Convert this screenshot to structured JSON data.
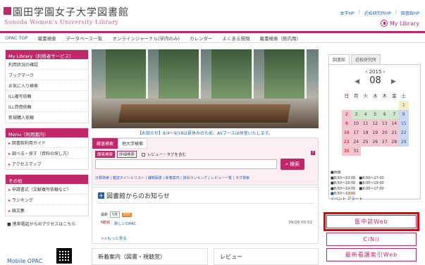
{
  "header": {
    "title": "園田学園女子大学図書館",
    "subtitle": "Sonoda Women's University Library",
    "top_links": [
      "本学HP",
      "近松研究所HP",
      "図書館HP"
    ],
    "mylibrary": "My Library"
  },
  "nav": [
    "OPAC TOP",
    "蔵書検索",
    "データベース一覧",
    "オンラインジャーナル(学内のみ)",
    "カレンダー",
    "よくある質問",
    "蔵書検索（館内用）"
  ],
  "sidebar": {
    "mylibrary": {
      "title": "My Library（利用者サービス）",
      "items": [
        "利用状況の確認",
        "ブックマーク",
        "お気に入り検索",
        "ILL複写依頼",
        "ILL貸借依頼",
        "新規購入依頼"
      ]
    },
    "menu": {
      "title": "Menu（利用案内）",
      "items": [
        "図書館利用ガイド",
        "調べる・探す（資料の探し方）",
        "アクセスマップ"
      ]
    },
    "other": {
      "title": "その他",
      "items": [
        "申請書式（文献複写依頼など）",
        "ランキング",
        "論文集"
      ]
    },
    "mobile_note": "■ 携帯電話からのアクセスはこちら",
    "mobile_label": "Mobile OPAC"
  },
  "notice": "【お知らせ】8/4～9/18は夏休みのため、AVブースは休室いたします。",
  "search": {
    "tabs": [
      "蔵書検索",
      "他大学検索"
    ],
    "modes": [
      "簡易検索",
      "詳細検索"
    ],
    "review_checkbox": "レビュー・タグを含む",
    "help": "?",
    "button": "検索",
    "links": "分類検索 | 雑誌タイトルリスト | 課題図書 | 新着案内 | 貸出ランキング | レビュー一覧 | タグ検索"
  },
  "news": {
    "title": "図書館からのお知らせ",
    "controls": [
      "最新",
      "5件",
      "RSS"
    ],
    "items": [
      {
        "badge": "NEW",
        "title": "新しいOPAC",
        "date": "09/26 00:51"
      }
    ],
    "more": ">>もっと見る"
  },
  "bottom": {
    "new_arrivals": "新着案内（図書・視聴覚）",
    "review": "レビュー"
  },
  "calendar": {
    "tabs": [
      "図書館",
      "近松研究所"
    ],
    "year": "2015",
    "month": "08",
    "weekdays": [
      "日",
      "月",
      "火",
      "水",
      "木",
      "金",
      "土"
    ],
    "weeks": [
      [
        "",
        "",
        "",
        "",
        "",
        "",
        "1"
      ],
      [
        "2",
        "3",
        "4",
        "5",
        "6",
        "7",
        "8"
      ],
      [
        "9",
        "10",
        "11",
        "12",
        "13",
        "14",
        "15"
      ],
      [
        "16",
        "17",
        "18",
        "19",
        "20",
        "21",
        "22"
      ],
      [
        "23",
        "24",
        "25",
        "26",
        "27",
        "28",
        "29"
      ],
      [
        "30",
        "31",
        "",
        "",
        "",
        "",
        ""
      ]
    ],
    "legend": [
      "■休館",
      "■8:50～10:00　■8:50～17:00",
      "■8:50～18:00　■9:00～19:00",
      "■8:50～19:00　■9:00～17:00",
      "■8:50～19:00"
    ],
    "icons": [
      "イベント",
      "アラート"
    ]
  },
  "external": {
    "buttons": [
      "医中誌Web",
      "CiNii",
      "最新看護索引Web"
    ]
  },
  "colors": {
    "accent": "#c0286a",
    "link": "#2a5fb0",
    "highlight": "#e00000"
  }
}
